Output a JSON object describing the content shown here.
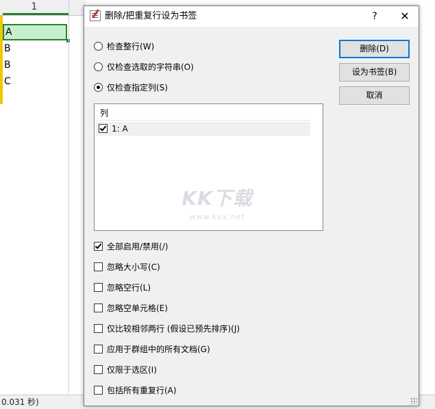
{
  "sheet": {
    "column_header": "1",
    "cells": [
      "A",
      "B",
      "B",
      "C"
    ],
    "status_text": "0.031 秒)"
  },
  "dialog": {
    "title": "删除/把重复行设为书签",
    "help_label": "?",
    "close_label": "✕",
    "radios": [
      {
        "label": "检查整行(W)",
        "checked": false
      },
      {
        "label": "仅检查选取的字符串(O)",
        "checked": false
      },
      {
        "label": "仅检查指定列(S)",
        "checked": true
      }
    ],
    "buttons": {
      "delete": "删除(D)",
      "bookmark": "设为书签(B)",
      "cancel": "取消"
    },
    "column_list": {
      "header": "列",
      "items": [
        {
          "label": "1: A",
          "checked": true
        }
      ]
    },
    "watermark": {
      "logo": "KK下载",
      "url": "www.kkx.net"
    },
    "options": [
      {
        "label": "全部启用/禁用(/)",
        "checked": true
      },
      {
        "label": "忽略大小写(C)",
        "checked": false
      },
      {
        "label": "忽略空行(L)",
        "checked": false
      },
      {
        "label": "忽略空单元格(E)",
        "checked": false
      },
      {
        "label": "仅比较相邻两行 (假设已预先排序)(J)",
        "checked": false
      },
      {
        "label": "应用于群组中的所有文档(G)",
        "checked": false
      },
      {
        "label": "仅限于选区(I)",
        "checked": false
      },
      {
        "label": "包括所有重复行(A)",
        "checked": false
      }
    ]
  }
}
